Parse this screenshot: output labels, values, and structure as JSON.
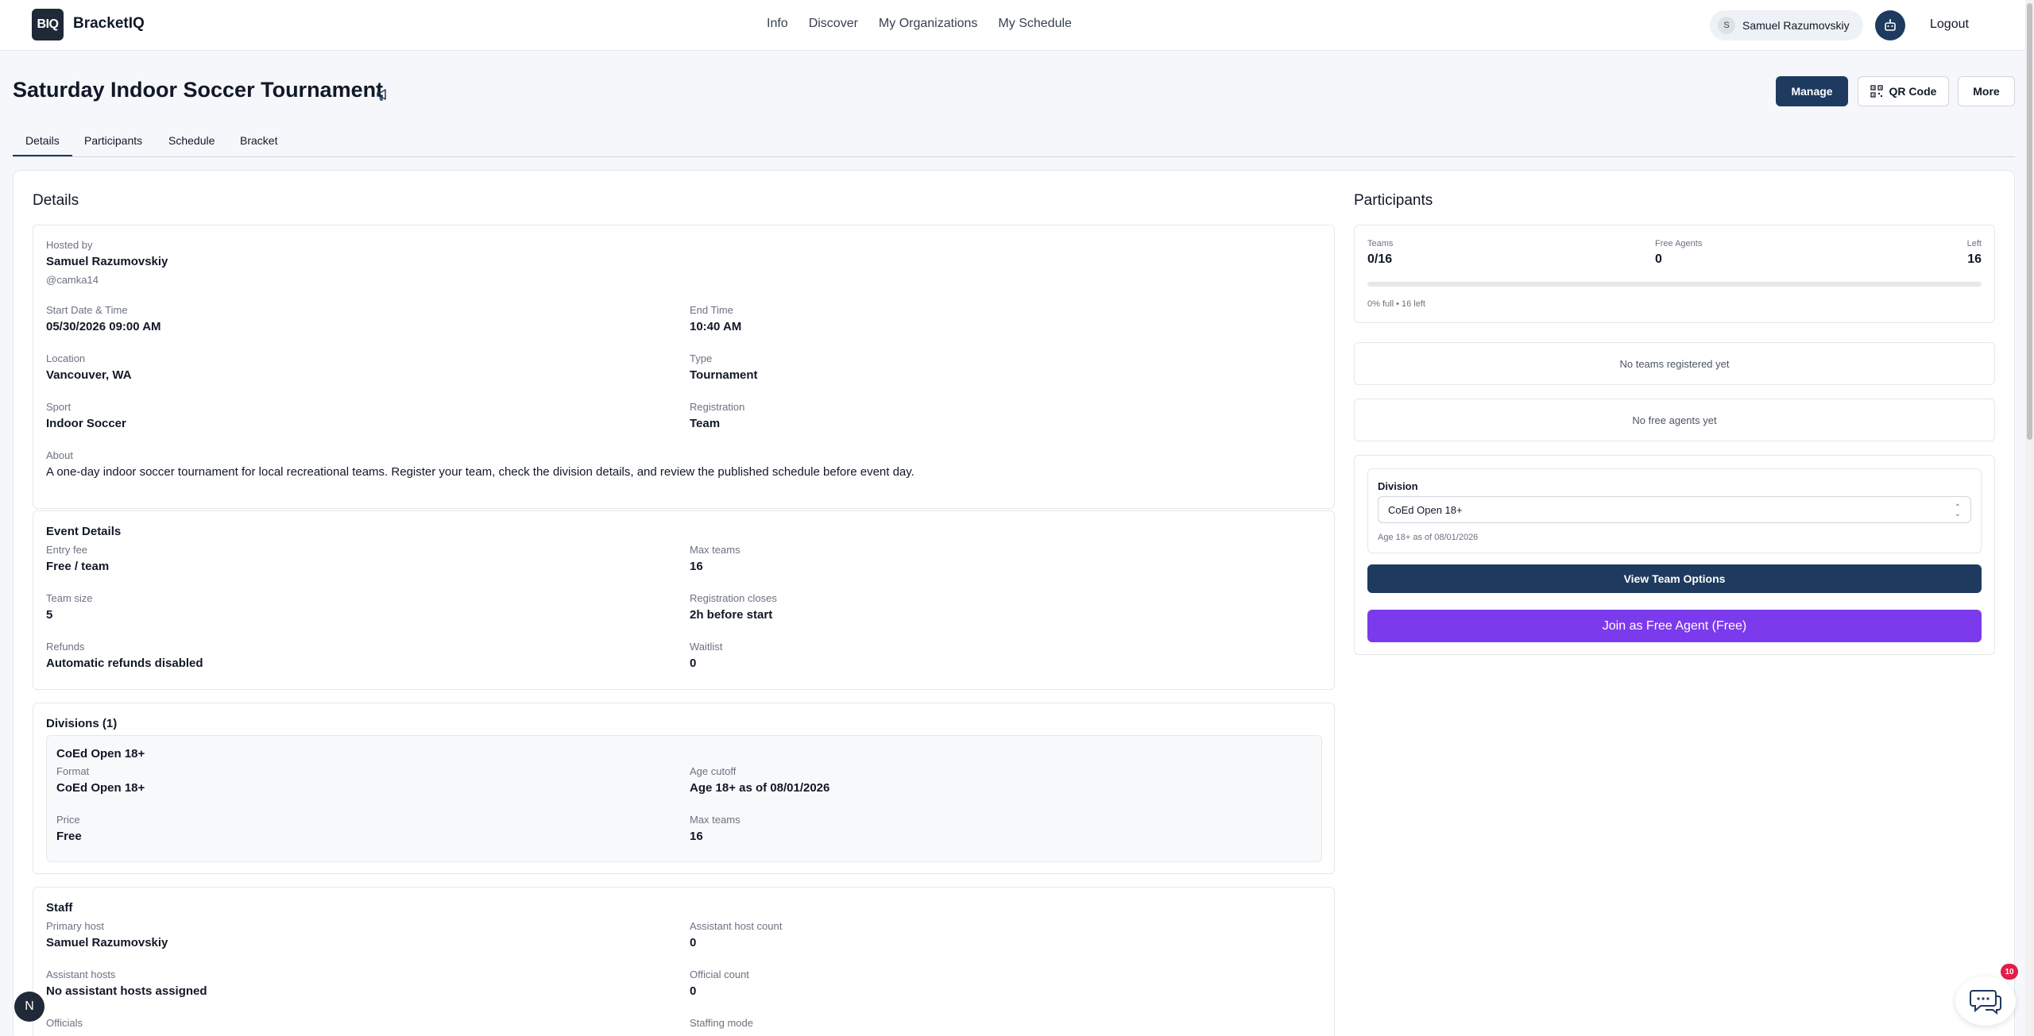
{
  "nav": {
    "logo_text": "BIQ",
    "brand": "BracketIQ",
    "links": [
      "Info",
      "Discover",
      "My Organizations",
      "My Schedule"
    ],
    "user_initial": "S",
    "user_name": "Samuel Razumovskiy",
    "logout": "Logout"
  },
  "header": {
    "title": "Saturday Indoor Soccer Tournament",
    "manage": "Manage",
    "qr_code": "QR Code",
    "more": "More"
  },
  "tabs": [
    "Details",
    "Participants",
    "Schedule",
    "Bracket"
  ],
  "details": {
    "heading": "Details",
    "hosted_by_label": "Hosted by",
    "hosted_by_name": "Samuel Razumovskiy",
    "hosted_by_handle": "@camka14",
    "start_label": "Start Date & Time",
    "start_value": "05/30/2026 09:00 AM",
    "end_label": "End Time",
    "end_value": "10:40 AM",
    "location_label": "Location",
    "location_value": "Vancouver, WA",
    "type_label": "Type",
    "type_value": "Tournament",
    "sport_label": "Sport",
    "sport_value": "Indoor Soccer",
    "registration_label": "Registration",
    "registration_value": "Team",
    "about_label": "About",
    "about_value": "A one-day indoor soccer tournament for local recreational teams. Register your team, check the division details, and review the published schedule before event day."
  },
  "event_details": {
    "title": "Event Details",
    "entry_fee_label": "Entry fee",
    "entry_fee_value": "Free / team",
    "max_teams_label": "Max teams",
    "max_teams_value": "16",
    "team_size_label": "Team size",
    "team_size_value": "5",
    "reg_closes_label": "Registration closes",
    "reg_closes_value": "2h before start",
    "refunds_label": "Refunds",
    "refunds_value": "Automatic refunds disabled",
    "waitlist_label": "Waitlist",
    "waitlist_value": "0"
  },
  "divisions": {
    "title": "Divisions (1)",
    "name": "CoEd Open 18+",
    "format_label": "Format",
    "format_value": "CoEd Open 18+",
    "age_label": "Age cutoff",
    "age_value": "Age 18+ as of 08/01/2026",
    "price_label": "Price",
    "price_value": "Free",
    "max_teams_label": "Max teams",
    "max_teams_value": "16"
  },
  "staff": {
    "title": "Staff",
    "primary_host_label": "Primary host",
    "primary_host_value": "Samuel Razumovskiy",
    "assistant_count_label": "Assistant host count",
    "assistant_count_value": "0",
    "assistant_hosts_label": "Assistant hosts",
    "assistant_hosts_value": "No assistant hosts assigned",
    "official_count_label": "Official count",
    "official_count_value": "0",
    "officials_label": "Officials",
    "staffing_mode_label": "Staffing mode"
  },
  "participants": {
    "heading": "Participants",
    "teams_label": "Teams",
    "teams_value": "0/16",
    "free_agents_label": "Free Agents",
    "free_agents_value": "0",
    "left_label": "Left",
    "left_value": "16",
    "fill_fraction": 0,
    "fill_text": "0% full • 16 left",
    "no_teams": "No teams registered yet",
    "no_agents": "No free agents yet",
    "division_label": "Division",
    "division_selected": "CoEd Open 18+",
    "division_hint": "Age 18+ as of 08/01/2026",
    "view_team_options": "View Team Options",
    "join_free_agent": "Join as Free Agent (Free)"
  },
  "floating": {
    "n_badge": "N",
    "chat_count": "10"
  },
  "colors": {
    "primary": "#1e3a5f",
    "accent_purple": "#7c3aed",
    "badge_red": "#e11d48"
  }
}
